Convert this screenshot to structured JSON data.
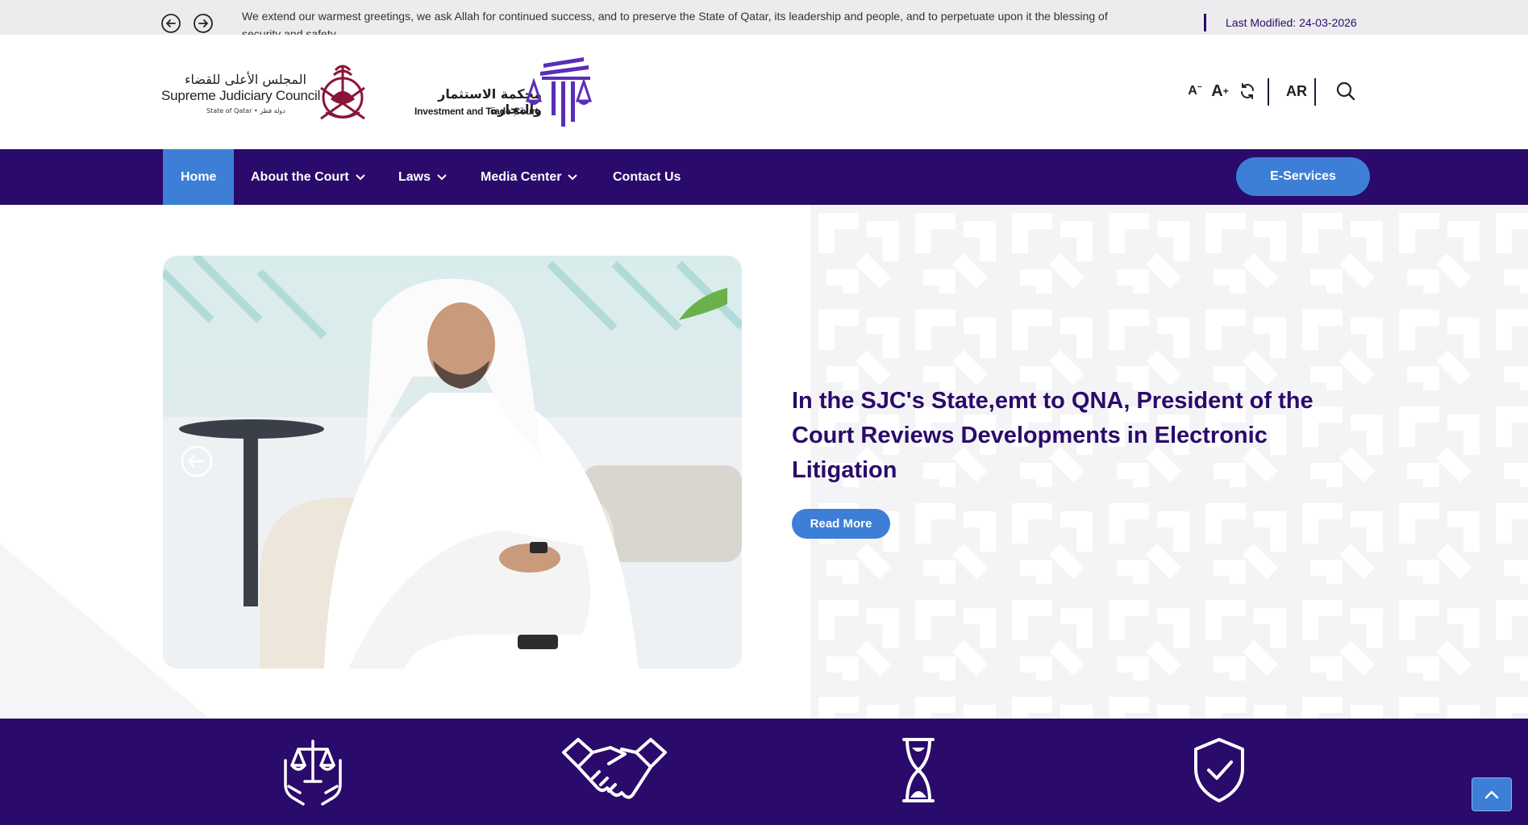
{
  "topbar": {
    "ticker": "We extend our warmest greetings, we ask Allah for continued success, and to preserve the State of Qatar, its leadership and people, and to perpetuate upon it the blessing of security and safety.",
    "last_modified_label": "Last Modified:",
    "last_modified_date": "24-03-2026",
    "prev_icon": "arrow-left-circle-icon",
    "next_icon": "arrow-right-circle-icon"
  },
  "logos": {
    "sjc": {
      "arabic": "المجلس الأعلى للقضاء",
      "english": "Supreme Judiciary Council",
      "sub": "State of Qatar • دولة قطر"
    },
    "itc": {
      "arabic": "محكمة الاستثمار والتجارة",
      "english": "Investment and Trade Court"
    }
  },
  "tools": {
    "font_decrease": "A",
    "font_increase": "A",
    "font_reset_icon": "refresh-icon",
    "language": "AR",
    "search_icon": "search-icon"
  },
  "nav": {
    "items": [
      {
        "label": "Home",
        "active": true
      },
      {
        "label": "About the Court",
        "dropdown": true
      },
      {
        "label": "Laws",
        "dropdown": true
      },
      {
        "label": "Media Center",
        "dropdown": true
      },
      {
        "label": "Contact Us"
      }
    ],
    "eservices": "E-Services"
  },
  "hero": {
    "title": "In the SJC's State,emt to QNA, President of the Court Reviews Developments in Electronic Litigation",
    "read_more": "Read More",
    "prev_icon": "arrow-left-icon"
  },
  "features": {
    "icons": [
      "justice-scales-hands-icon",
      "handshake-icon",
      "hourglass-icon",
      "shield-check-icon"
    ]
  },
  "scroll_top_icon": "chevron-up-icon",
  "colors": {
    "brand_purple": "#2a0a6b",
    "accent_blue": "#3d7fd6",
    "topbar_bg": "#ececee"
  }
}
